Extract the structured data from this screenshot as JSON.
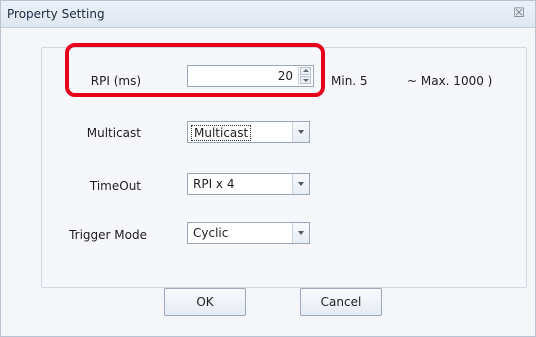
{
  "window": {
    "title": "Property Setting",
    "close_glyph": "☒"
  },
  "rpi": {
    "label": "RPI (ms)",
    "value": "20",
    "min_text": "Min. 5",
    "max_text": "~ Max. 1000   )"
  },
  "multicast": {
    "label": "Multicast",
    "selected": "Multicast"
  },
  "timeout": {
    "label": "TimeOut",
    "selected": "RPI x 4"
  },
  "trigger": {
    "label": "Trigger Mode",
    "selected": "Cyclic"
  },
  "buttons": {
    "ok": "OK",
    "cancel": "Cancel"
  },
  "colors": {
    "highlight": "#e8001a",
    "title_bar": "#dfe7f1"
  }
}
